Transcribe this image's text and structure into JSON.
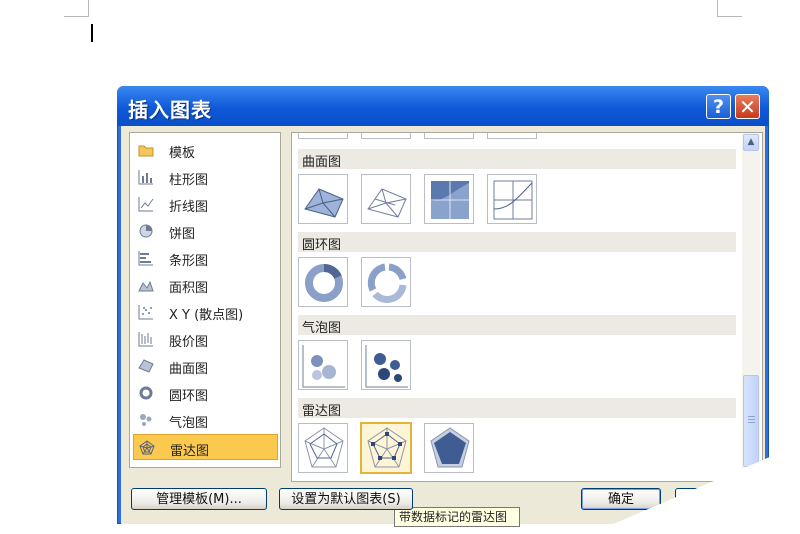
{
  "dialog": {
    "title": "插入图表",
    "help_label": "?",
    "close_label": "✕"
  },
  "categories": [
    {
      "label": "模板",
      "icon": "folder-icon"
    },
    {
      "label": "柱形图",
      "icon": "column-chart-icon"
    },
    {
      "label": "折线图",
      "icon": "line-chart-icon"
    },
    {
      "label": "饼图",
      "icon": "pie-chart-icon"
    },
    {
      "label": "条形图",
      "icon": "bar-chart-icon"
    },
    {
      "label": "面积图",
      "icon": "area-chart-icon"
    },
    {
      "label": "X Y (散点图)",
      "icon": "scatter-chart-icon"
    },
    {
      "label": "股价图",
      "icon": "stock-chart-icon"
    },
    {
      "label": "曲面图",
      "icon": "surface-chart-icon"
    },
    {
      "label": "圆环图",
      "icon": "doughnut-chart-icon"
    },
    {
      "label": "气泡图",
      "icon": "bubble-chart-icon"
    },
    {
      "label": "雷达图",
      "icon": "radar-chart-icon",
      "selected": true
    }
  ],
  "groups": [
    {
      "label": "曲面图"
    },
    {
      "label": "圆环图"
    },
    {
      "label": "气泡图"
    },
    {
      "label": "雷达图"
    }
  ],
  "tooltip": "带数据标记的雷达图",
  "buttons": {
    "manage_templates": "管理模板(M)...",
    "set_default": "设置为默认图表(S)",
    "ok": "确定"
  },
  "colors": {
    "title_bar": "#0f58d8",
    "selection": "#fbc94e",
    "tooltip_bg": "#ffffe1"
  }
}
